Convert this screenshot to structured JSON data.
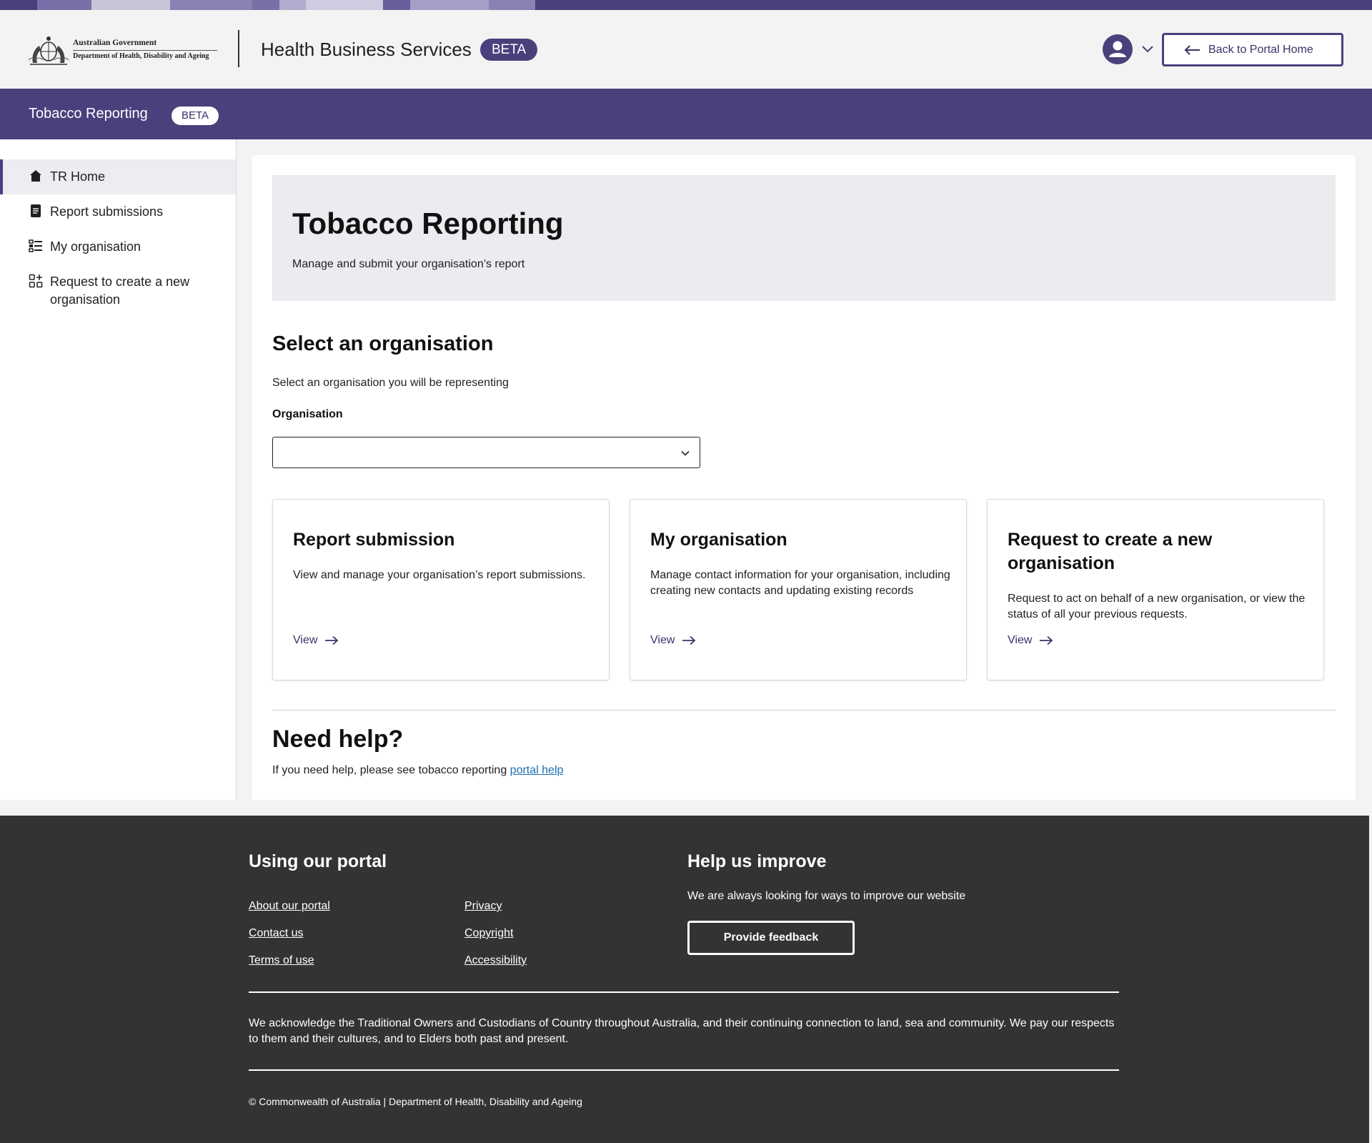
{
  "colors": {
    "brand_purple": "#4b3f7c",
    "footer_bg": "#333333",
    "link_blue": "#1e6fb0",
    "hero_bg": "#ebebf0"
  },
  "header": {
    "gov_line_1": "Australian Government",
    "gov_line_2": "Department of Health, Disability and Ageing",
    "app_title": "Health Business Services",
    "beta_label": "BETA",
    "user_icon": "user-avatar-icon",
    "back_button_label": "Back to Portal Home"
  },
  "subbar": {
    "title": "Tobacco Reporting",
    "beta_label": "BETA"
  },
  "sidebar": {
    "items": [
      {
        "label": "TR Home",
        "icon": "home-icon",
        "active": true
      },
      {
        "label": "Report submissions",
        "icon": "document-icon",
        "active": false
      },
      {
        "label": "My organisation",
        "icon": "list-icon",
        "active": false
      },
      {
        "label": "Request to create a new organisation",
        "icon": "grid-icon",
        "active": false
      }
    ]
  },
  "hero": {
    "title": "Tobacco Reporting",
    "subtitle": "Manage and submit your organisation’s report"
  },
  "select_org": {
    "heading": "Select an organisation",
    "description": "Select an organisation you will be representing",
    "field_label": "Organisation",
    "selected_value": ""
  },
  "cards": [
    {
      "title": "Report submission",
      "description": "View and manage your organisation’s report submissions.",
      "link_label": "View"
    },
    {
      "title": "My organisation",
      "description": "Manage contact information for your organisation, including creating new contacts and updating existing records",
      "link_label": "View"
    },
    {
      "title": "Request to create a new organisation",
      "description": "Request to act on behalf of a new organisation, or view the status of all your previous requests.",
      "link_label": "View"
    }
  ],
  "help": {
    "title": "Need help?",
    "text_prefix": "If you need help, please see tobacco reporting ",
    "link_label": "portal help"
  },
  "footer": {
    "using_heading": "Using our portal",
    "links_col1": [
      "About our portal",
      "Contact us",
      "Terms of use"
    ],
    "links_col2": [
      "Privacy",
      "Copyright",
      "Accessibility"
    ],
    "improve_heading": "Help us improve",
    "improve_text": "We are always looking for ways to improve our website",
    "feedback_button": "Provide feedback",
    "acknowledgement": "We acknowledge the Traditional Owners and Custodians of Country throughout Australia, and their continuing connection to land, sea and community. We pay our respects to them and their cultures, and to Elders both past and present.",
    "copyright": "© Commonwealth of Australia | Department of Health, Disability and Ageing"
  }
}
